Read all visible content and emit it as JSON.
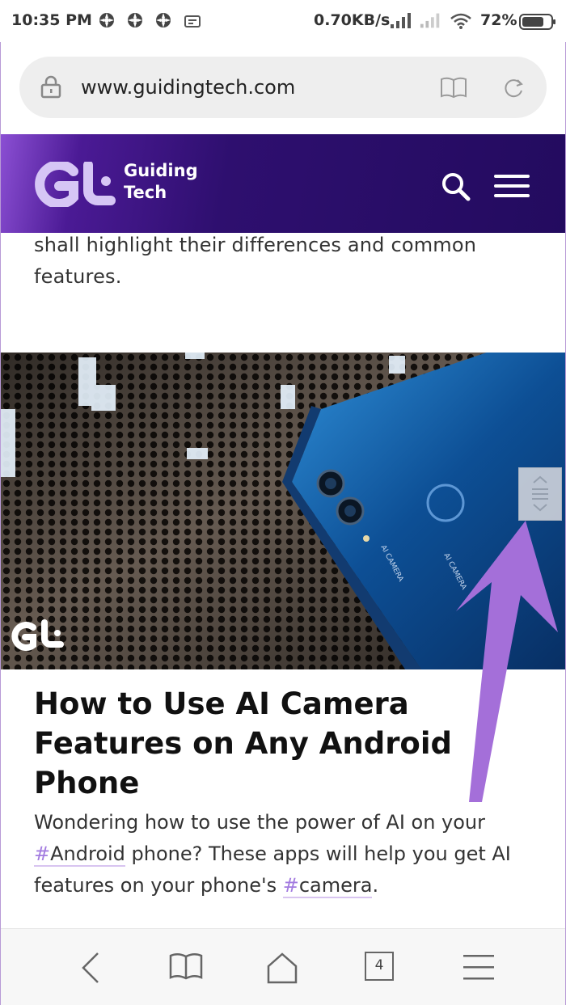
{
  "status_bar": {
    "time": "10:35 PM",
    "net_speed": "0.70KB/s",
    "battery": "72%"
  },
  "address_bar": {
    "url": "www.guidingtech.com"
  },
  "site_header": {
    "brand_line1": "Guiding",
    "brand_line2": "Tech"
  },
  "article": {
    "lead_text": "shall highlight their differences and common features.",
    "title": "How to Use AI Camera Features on Any Android Phone",
    "desc_part1": "Wondering how to use the power of AI on your ",
    "tag1": "Android",
    "desc_part2": " phone? These apps will help you get AI features on your phone's ",
    "tag2": "camera",
    "desc_part3": ".",
    "hash": "#",
    "phone_print": "AI CAMERA"
  },
  "bottom_nav": {
    "tab_count": "4"
  },
  "colors": {
    "header_bg": "#230b5f",
    "accent": "#a37be0",
    "arrow": "#a46fd9"
  }
}
